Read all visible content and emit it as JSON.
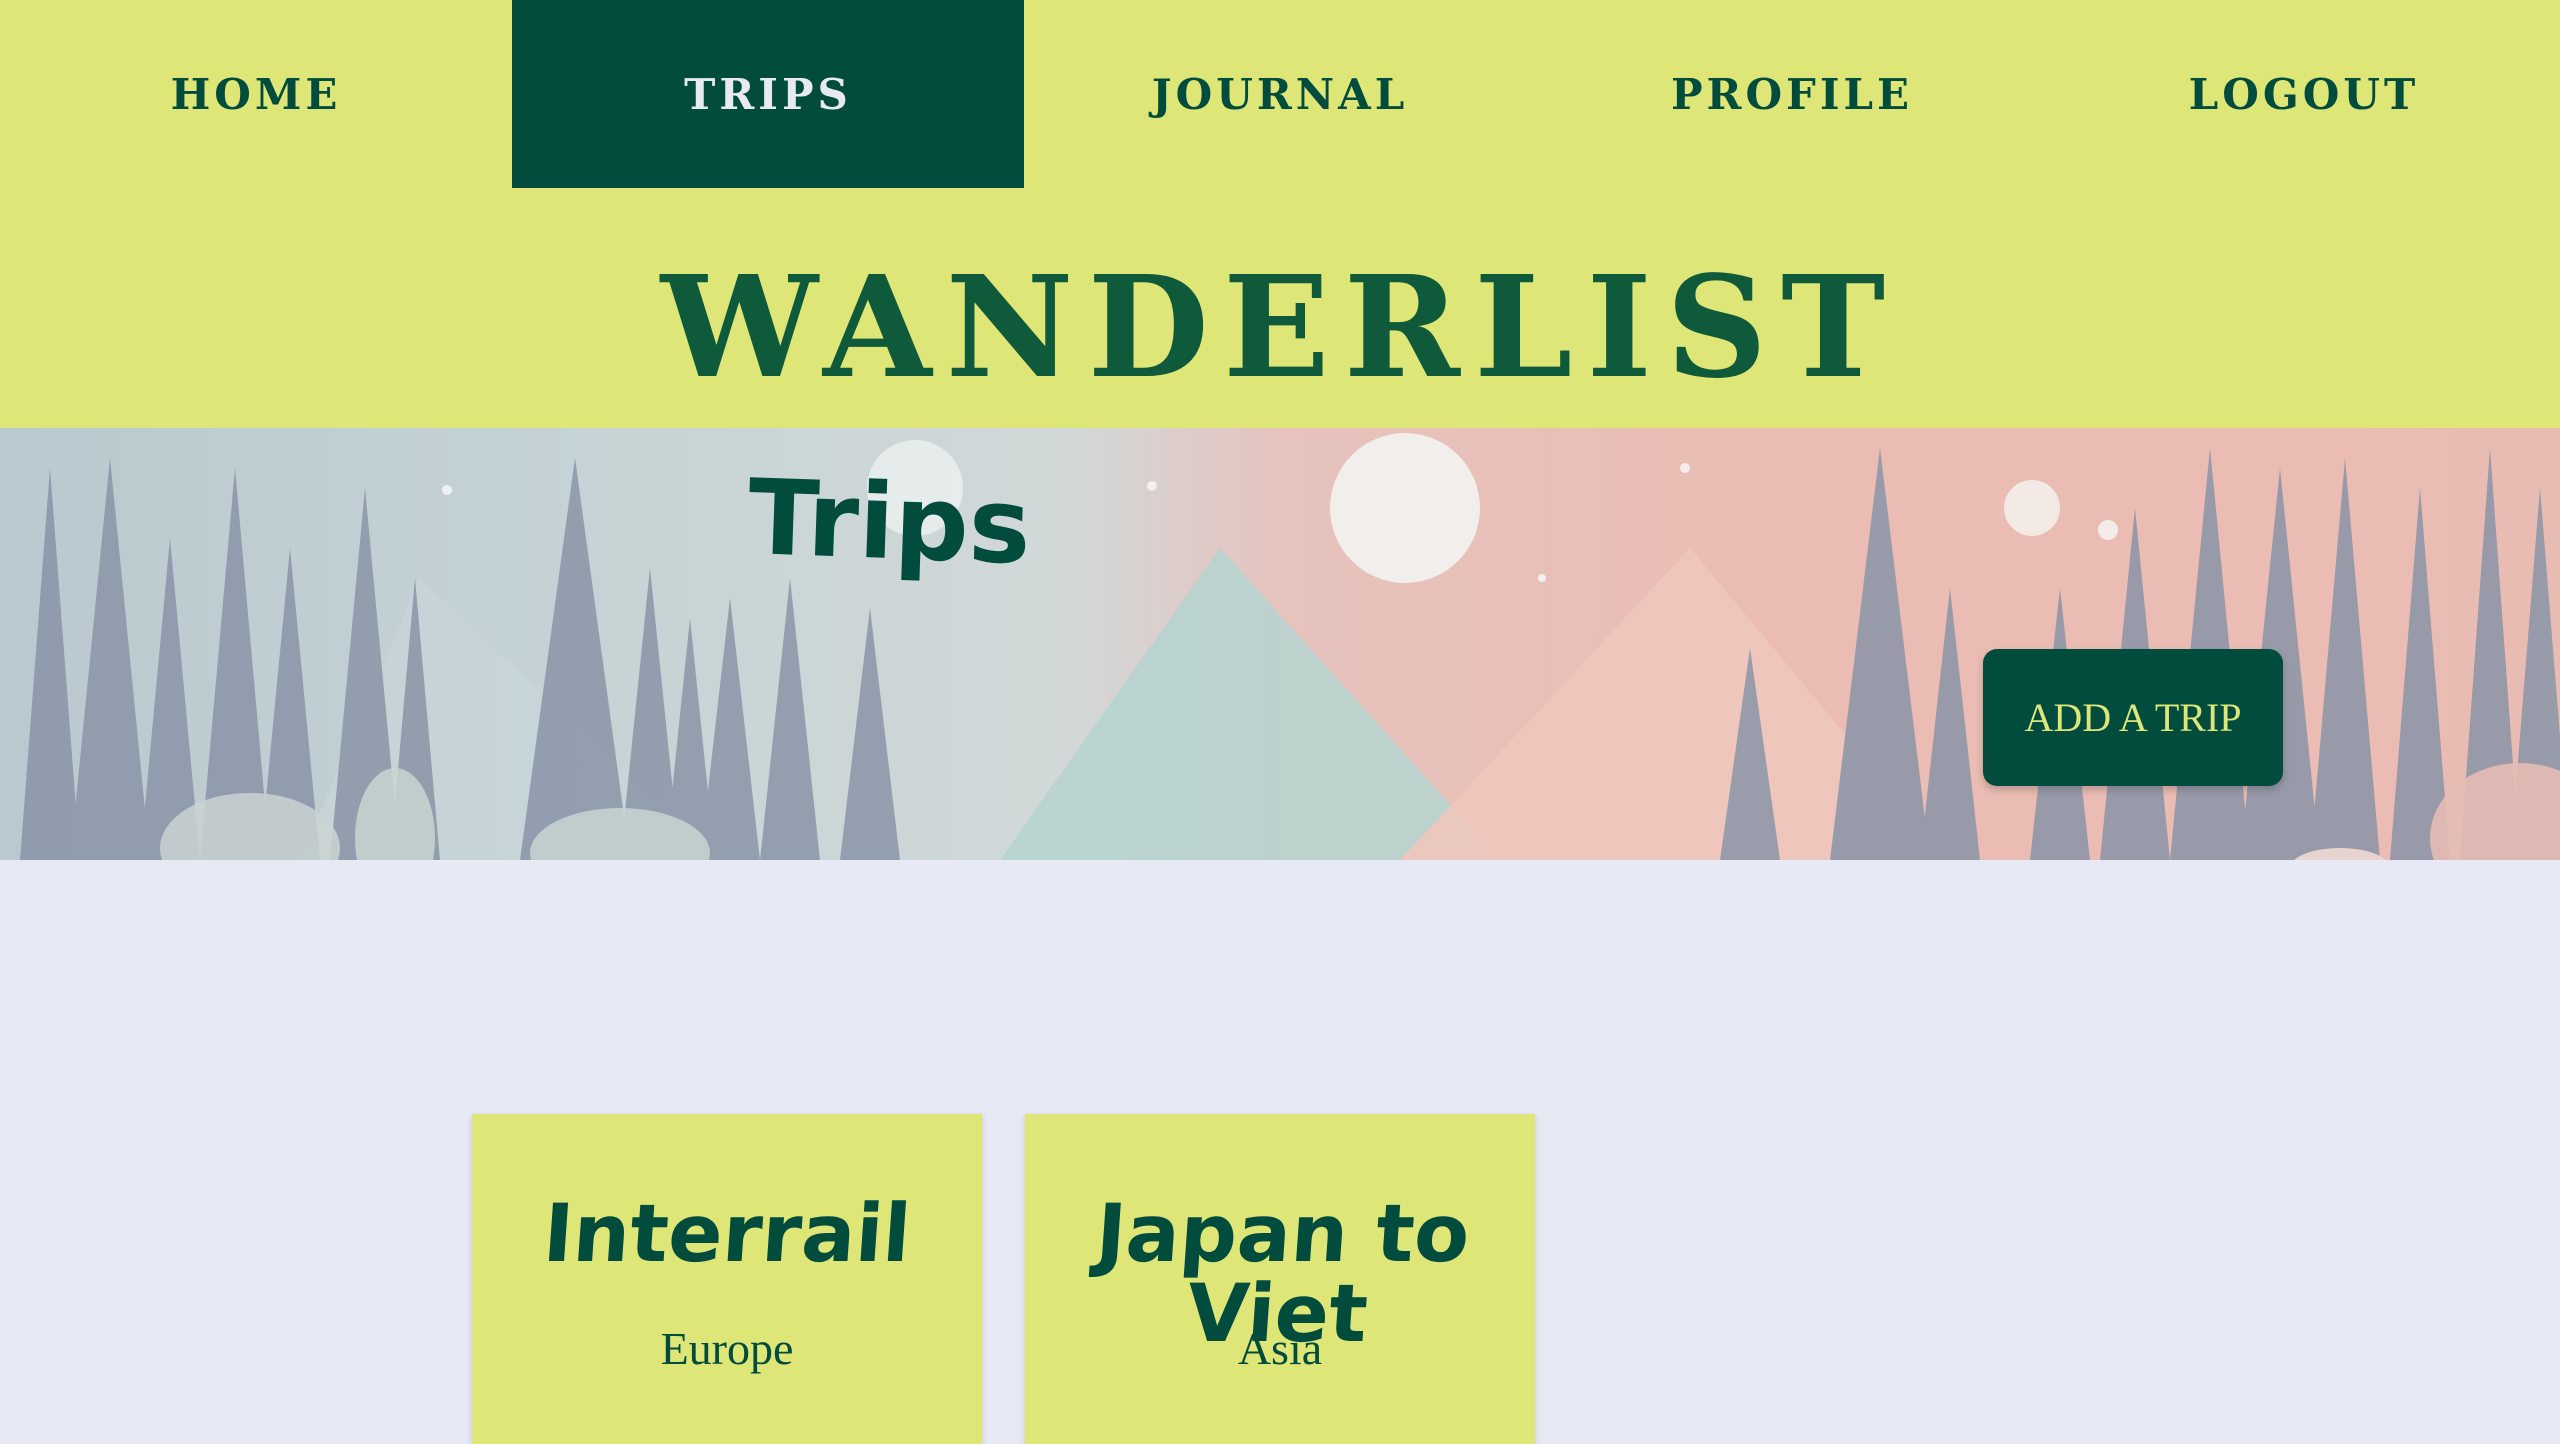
{
  "nav": {
    "items": [
      {
        "label": "HOME"
      },
      {
        "label": "TRIPS"
      },
      {
        "label": "JOURNAL"
      },
      {
        "label": "PROFILE"
      },
      {
        "label": "LOGOUT"
      }
    ],
    "active": "TRIPS"
  },
  "header": {
    "site_title": "WANDERLIST"
  },
  "hero": {
    "page_title": "Trips",
    "add_button_label": "ADD A TRIP"
  },
  "trips": [
    {
      "title": "Interrail",
      "region": "Europe"
    },
    {
      "title": "Japan to Viet",
      "region": "Asia"
    }
  ],
  "colors": {
    "accent": "#dde676",
    "brand": "#024c3e",
    "background": "#e7e9f4"
  }
}
